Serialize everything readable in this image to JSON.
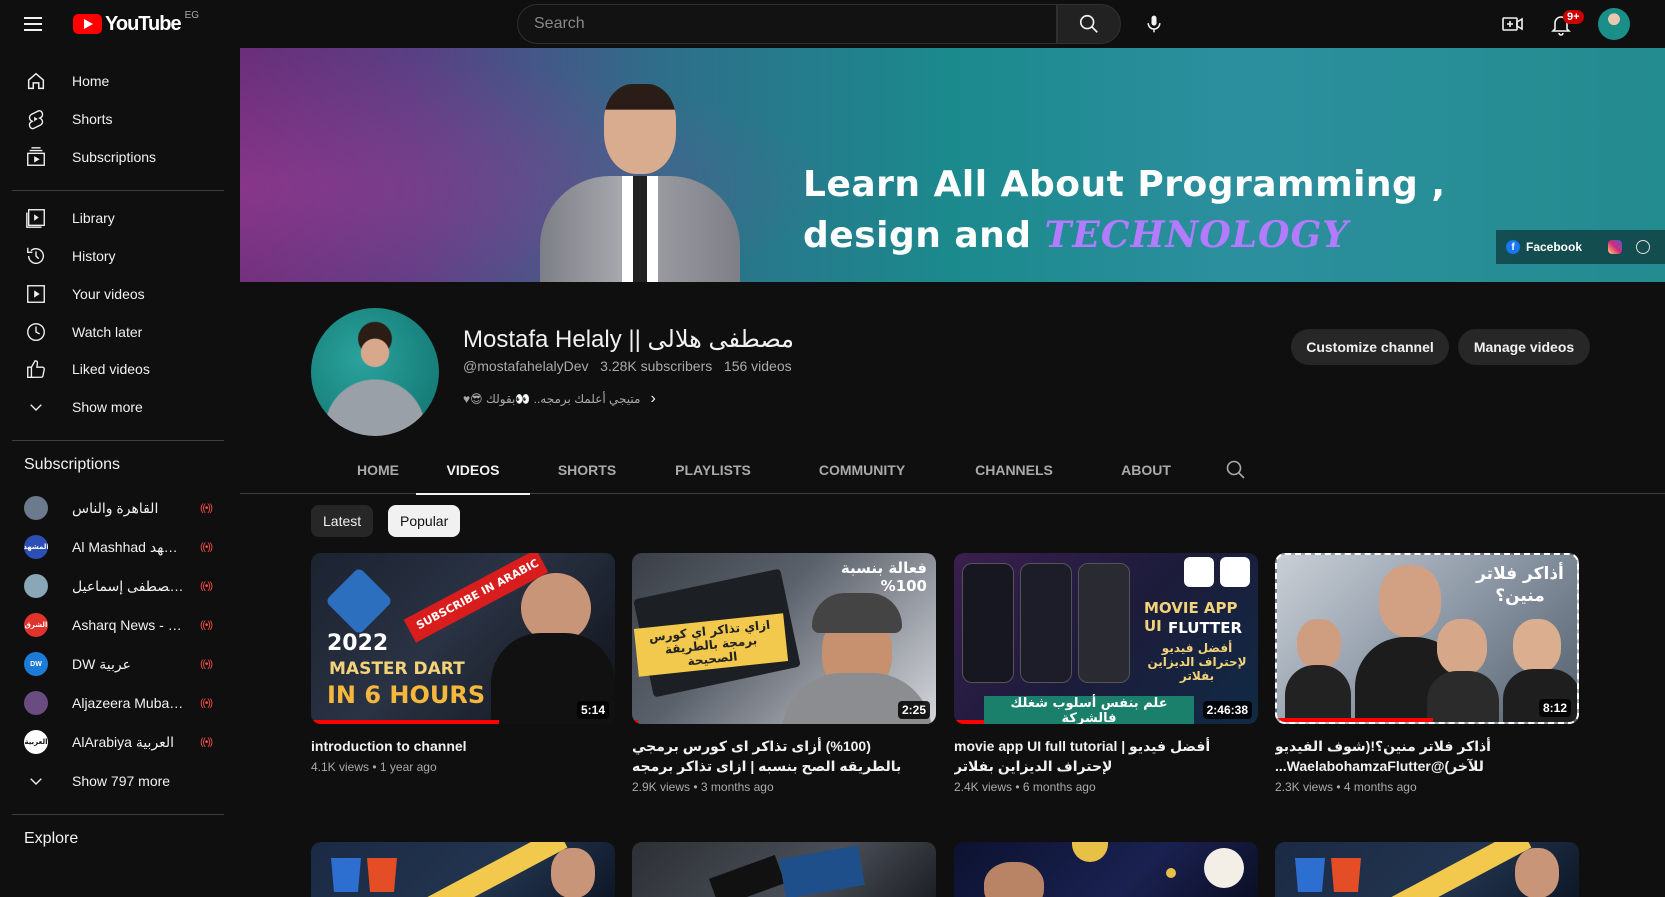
{
  "topbar": {
    "logo_text": "YouTube",
    "country_code": "EG",
    "search_placeholder": "Search",
    "notifications_badge": "9+"
  },
  "sidebar": {
    "main": [
      {
        "label": "Home",
        "icon": "home-icon"
      },
      {
        "label": "Shorts",
        "icon": "shorts-icon"
      },
      {
        "label": "Subscriptions",
        "icon": "subscriptions-icon"
      }
    ],
    "library": [
      {
        "label": "Library",
        "icon": "library-icon"
      },
      {
        "label": "History",
        "icon": "history-icon"
      },
      {
        "label": "Your videos",
        "icon": "your-videos-icon"
      },
      {
        "label": "Watch later",
        "icon": "watch-later-icon"
      },
      {
        "label": "Liked videos",
        "icon": "liked-videos-icon"
      },
      {
        "label": "Show more",
        "icon": "chevron-down-icon"
      }
    ],
    "subscriptions_heading": "Subscriptions",
    "subscriptions": [
      {
        "label": "القاهرة والناس",
        "avatar_color": "#6b7a8c",
        "avatar_text": "",
        "live": true
      },
      {
        "label": "Al Mashhad المشهد",
        "avatar_color": "#2b4fb5",
        "avatar_text": "المشهد",
        "live": true
      },
      {
        "label": "الشيخ مصطفى إسماعيل",
        "avatar_color": "#8aa7b8",
        "avatar_text": "",
        "live": true
      },
      {
        "label": "Asharq News - الشرق",
        "avatar_color": "#e0332c",
        "avatar_text": "الشرق",
        "live": true
      },
      {
        "label": "DW عربية",
        "avatar_color": "#1d7bd8",
        "avatar_text": "DW",
        "live": true
      },
      {
        "label": "Aljazeera Mubasher",
        "avatar_color": "#6a4c80",
        "avatar_text": "",
        "live": true
      },
      {
        "label": "AlArabiya العربية",
        "avatar_color": "#ffffff",
        "avatar_text": "العربية",
        "live": true
      }
    ],
    "show_more_subs": "Show 797 more",
    "explore_heading": "Explore"
  },
  "banner": {
    "line1": "Learn All About Programming ,",
    "line2_prefix": "design and ",
    "line2_accent": "TECHNOLOGY",
    "facebook_label": "Facebook"
  },
  "channel": {
    "name": "Mostafa Helaly || مصطفى هلالى",
    "handle": "@mostafahelalyDev",
    "subscribers": "3.28K subscribers",
    "videos_count": "156 videos",
    "description": "♥😎 متيجي أعلمك برمجه.. 👀بقولك",
    "customize_label": "Customize channel",
    "manage_label": "Manage videos"
  },
  "tabs": [
    "HOME",
    "VIDEOS",
    "SHORTS",
    "PLAYLISTS",
    "COMMUNITY",
    "CHANNELS",
    "ABOUT"
  ],
  "active_tab": "VIDEOS",
  "chips": [
    "Latest",
    "Popular"
  ],
  "active_chip": "Popular",
  "videos": [
    {
      "title": "introduction to channel",
      "views": "4.1K views",
      "age": "1 year ago",
      "duration": "5:14",
      "thumb_text_1": "2022",
      "thumb_text_2": "MASTER DART",
      "thumb_text_3": "IN 6 HOURS",
      "thumb_ribbon": "SUBSCRIBE IN ARABIC",
      "progress": 0.62
    },
    {
      "title": "(%100) أزاى تذاكر اى كورس برمجي بالطريقه الصح بنسبه | ازاى تذاكر برمجه صح؟",
      "views": "2.9K views",
      "age": "3 months ago",
      "duration": "2:25",
      "thumb_text_1": "فعالة بنسبة 100%",
      "thumb_text_2": "ازاي تذاكر اي كورس برمجة بالطريقة الصحيحة",
      "progress": 0.02
    },
    {
      "title": "movie app UI full tutorial | أفضل فيديو لإحتراف الديزاين بفلاتر",
      "views": "2.4K views",
      "age": "6 months ago",
      "duration": "2:46:38",
      "thumb_text_1": "MOVIE APP UI",
      "thumb_text_2": "FLUTTER",
      "thumb_text_3": "أفضل فيديو لإحتراف الديزاين بفلاتر",
      "thumb_text_4": "علم بنفس أسلوب شغلك فالشركة",
      "progress": 0.1
    },
    {
      "title": "أذاكر فلاتر منين؟!(شوف الفيديو للآخر)@WaelabohamzaFlutter...",
      "views": "2.3K views",
      "age": "4 months ago",
      "duration": "8:12",
      "thumb_text_1": "أذاكر فلاتر منين؟",
      "progress": 0.52
    }
  ]
}
